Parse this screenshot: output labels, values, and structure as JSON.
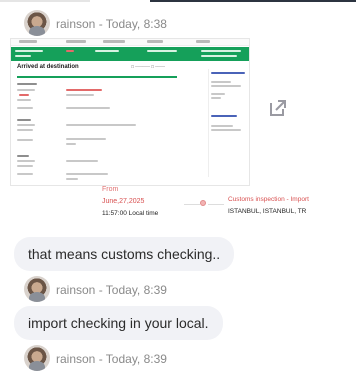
{
  "colors": {
    "accent_green": "#15a05a",
    "accent_red": "#d85050",
    "bubble_bg": "#f1f2f6",
    "meta_text": "#8a8a8a"
  },
  "messages": [
    {
      "sender": "rainson",
      "time": "Today, 8:38",
      "meta": "rainson - Today, 8:38"
    },
    {
      "sender": "rainson",
      "time": "Today, 8:39",
      "meta": "rainson - Today, 8:39"
    },
    {
      "sender": "rainson",
      "time": "Today, 8:39",
      "meta": "rainson - Today, 8:39"
    }
  ],
  "attachment": {
    "title": "Arrived at destination",
    "expand_icon": "open-in-new-icon"
  },
  "tracking": {
    "from_label": "From",
    "date": "June,27,2025",
    "local_time": "11:57:00 Local time",
    "status": "Customs inspection - Import",
    "location": "ISTANBUL, ISTANBUL, TR"
  },
  "bubbles": [
    "that means customs checking..",
    "import checking in your local."
  ]
}
